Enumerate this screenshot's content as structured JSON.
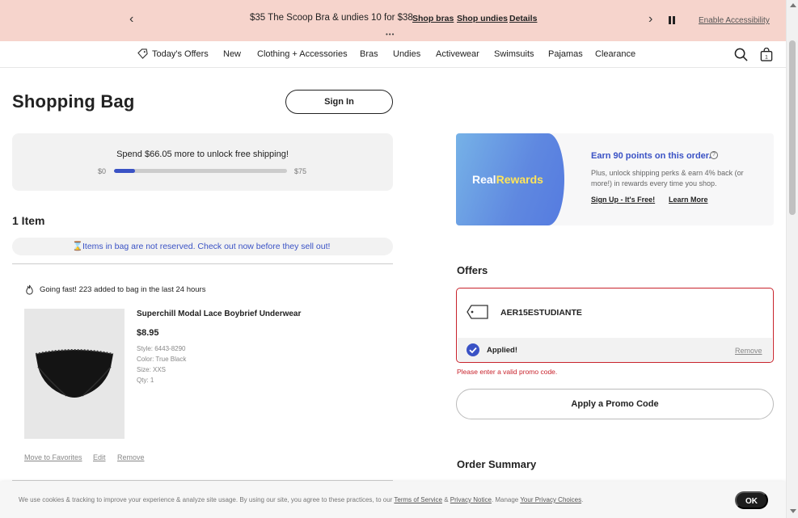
{
  "promo_banner": {
    "prev_glyph": "‹",
    "next_glyph": "›",
    "message": "$35 The Scoop Bra & undies 10 for $38",
    "links": [
      "Shop bras",
      "Shop undies",
      "Details"
    ],
    "dots": "•••",
    "accessibility_label": "Enable Accessibility"
  },
  "nav": {
    "items": [
      "Today's Offers",
      "New",
      "Clothing + Accessories",
      "Bras",
      "Undies",
      "Activewear",
      "Swimsuits",
      "Pajamas",
      "Clearance"
    ],
    "bag_count": "1"
  },
  "page": {
    "title": "Shopping Bag",
    "sign_in_label": "Sign In"
  },
  "shipping": {
    "message": "Spend $66.05 more to unlock free shipping!",
    "min_label": "$0",
    "max_label": "$75",
    "progress_fraction": 0.12
  },
  "bag": {
    "item_count": "1 Item",
    "reserve_note": "Items in bag are not reserved. Check out now before they sell out!",
    "fast_note": "Going fast! 223 added to bag in the last 24 hours",
    "product": {
      "name": "Superchill Modal Lace Boybrief Underwear",
      "price": "$8.95",
      "style": "Style: 6443-8290",
      "color": "Color: True Black",
      "size": "Size: XXS",
      "qty": "Qty: 1"
    },
    "actions": [
      "Move to Favorites",
      "Edit",
      "Remove"
    ]
  },
  "rewards": {
    "logo_real": "Real",
    "logo_rewards": "Rewards",
    "title": "Earn 90 points on this order.",
    "info_glyph": "?",
    "description": "Plus, unlock shipping perks & earn 4% back (or more!) in rewards every time you shop.",
    "sign_up_label": "Sign Up - It's Free!",
    "learn_more_label": "Learn More"
  },
  "offers": {
    "title": "Offers",
    "code": "AER15ESTUDIANTE",
    "applied_label": "Applied!",
    "remove_label": "Remove",
    "error": "Please enter a valid promo code.",
    "apply_button": "Apply a Promo Code"
  },
  "summary": {
    "title": "Order Summary"
  },
  "cookie": {
    "text_before": "We use cookies & tracking to improve your experience & analyze site usage. By using our site, you agree to these practices, to our ",
    "terms_label": "Terms of Service",
    "amp": " & ",
    "privacy_label": "Privacy Notice",
    "manage_text": ". Manage ",
    "choices_label": "Your Privacy Choices",
    "period": ".",
    "ok_label": "OK"
  },
  "colors": {
    "banner_bg": "#f6d4cc",
    "accent_blue": "#3a52c5",
    "error_red": "#c8232c",
    "rewards_yellow": "#ffe45a"
  }
}
